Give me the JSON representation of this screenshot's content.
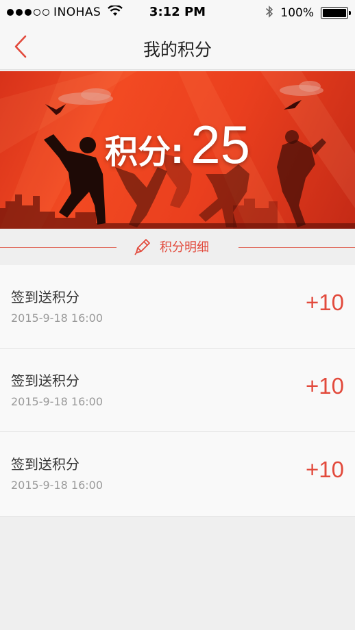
{
  "status_bar": {
    "carrier": "INOHAS",
    "time": "3:12 PM",
    "battery": "100%",
    "battery_level": 1.0,
    "signal_bars_filled": 3,
    "signal_bars_total": 5
  },
  "nav": {
    "title": "我的积分",
    "back_icon": "chevron-left-icon"
  },
  "banner": {
    "points_label": "积分:",
    "points_value": "25"
  },
  "section": {
    "title": "积分明细",
    "icon": "pencil-icon"
  },
  "records": [
    {
      "title": "签到送积分",
      "time": "2015-9-18 16:00",
      "points": "+10"
    },
    {
      "title": "签到送积分",
      "time": "2015-9-18 16:00",
      "points": "+10"
    },
    {
      "title": "签到送积分",
      "time": "2015-9-18 16:00",
      "points": "+10"
    }
  ],
  "colors": {
    "accent": "#e24a3c",
    "banner_red": "#f24a22",
    "background": "#efefef"
  }
}
